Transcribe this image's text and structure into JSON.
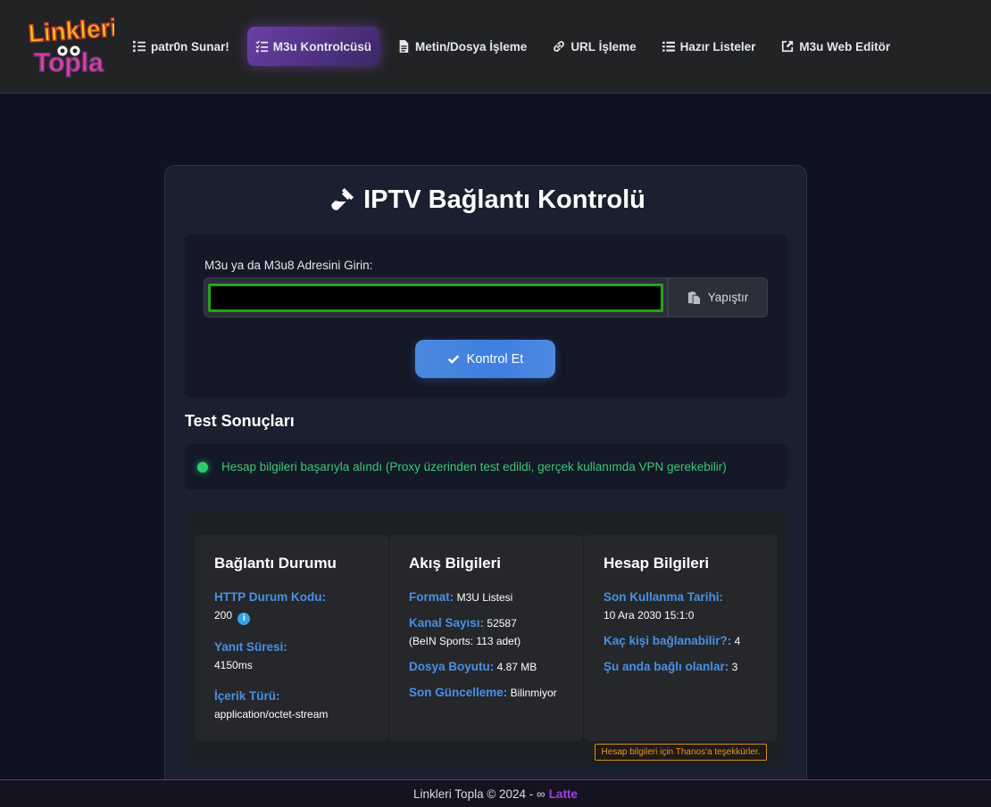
{
  "header": {
    "logo_line1": "Linkleri",
    "logo_line2": "Topla",
    "nav": [
      {
        "label": "patr0n Sunar!",
        "icon": "list-ol-icon"
      },
      {
        "label": "M3u Kontrolcüsü",
        "icon": "list-check-icon"
      },
      {
        "label": "Metin/Dosya İşleme",
        "icon": "file-icon"
      },
      {
        "label": "URL İşleme",
        "icon": "link-icon"
      },
      {
        "label": "Hazır Listeler",
        "icon": "list-icon"
      },
      {
        "label": "M3u Web Editör",
        "icon": "external-link-icon"
      }
    ],
    "active_index": 1
  },
  "main": {
    "title": "IPTV Bağlantı Kontrolü",
    "input_label": "M3u ya da M3u8 Adresini Girin:",
    "url_value": "",
    "paste_label": "Yapıştır",
    "check_label": "Kontrol Et",
    "results_title": "Test Sonuçları",
    "status_text": "Hesap bilgileri başarıyla alındı (Proxy üzerinden test edildi, gerçek kullanımda VPN gerekebilir)"
  },
  "connection": {
    "title": "Bağlantı Durumu",
    "http_label": "HTTP Durum Kodu:",
    "http_value": "200",
    "response_label": "Yanıt Süresi:",
    "response_value": "4150ms",
    "content_label": "İçerik Türü:",
    "content_value": "application/octet-stream"
  },
  "stream": {
    "title": "Akış Bilgileri",
    "format_label": "Format:",
    "format_value": "M3U Listesi",
    "channels_label": "Kanal Sayısı:",
    "channels_value": "52587",
    "channels_sub": "(BeIN Sports: 113 adet)",
    "size_label": "Dosya Boyutu:",
    "size_value": "4.87 MB",
    "updated_label": "Son Güncelleme:",
    "updated_value": "Bilinmiyor"
  },
  "account": {
    "title": "Hesap Bilgileri",
    "expiry_label": "Son Kullanma Tarihi:",
    "expiry_value": "10 Ara 2030 15:1:0",
    "max_label": "Kaç kişi bağlanabilir?:",
    "max_value": "4",
    "active_label": "Şu anda bağlı olanlar:",
    "active_value": "3",
    "thanks": "Hesap bilgileri için Thanos'a teşekkürler."
  },
  "footer": {
    "text": "Linkleri Topla © 2024 - ∞",
    "link": "Latte"
  },
  "colors": {
    "accent": "#4a90e2",
    "success": "#2ecc71",
    "nav_active": "#6b3fa8",
    "footer_link": "#a040e8"
  }
}
